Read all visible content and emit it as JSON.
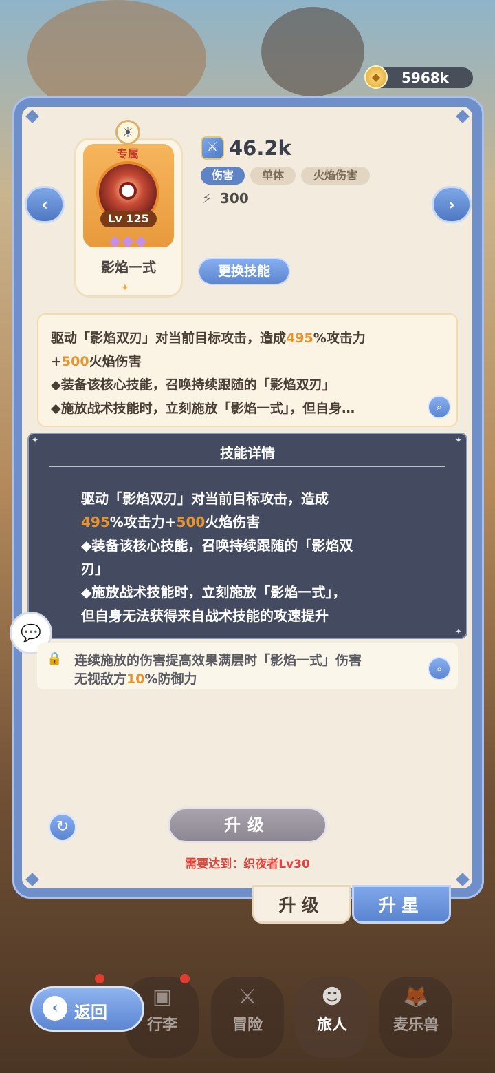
{
  "currency": {
    "icon": "coin-icon",
    "amount": "5968k"
  },
  "skill": {
    "exclusive_label": "专属",
    "level": "Lv 125",
    "stars": "◆◆◆",
    "name": "影焰一式",
    "power": "46.2k",
    "tags": [
      "伤害",
      "单体",
      "火焰伤害"
    ],
    "energy": "300",
    "change_button": "更换技能"
  },
  "description": {
    "line1_a": "驱动「影焰双刃」对当前目标攻击，造成",
    "line1_hl": "495",
    "line1_b": "%攻击力",
    "line2_a": "+",
    "line2_hl": "500",
    "line2_b": "火焰伤害",
    "line3": "◆装备该核心技能，召唤持续跟随的「影焰双刃」",
    "line4": "◆施放战术技能时，立刻施放「影焰一式」，但自身…"
  },
  "tooltip": {
    "title": "技能详情",
    "line1": "驱动「影焰双刃」对当前目标攻击，造成",
    "line2_hl1": "495",
    "line2_a": "%攻击力+",
    "line2_hl2": "500",
    "line2_b": "火焰伤害",
    "line3": "◆装备该核心技能，召唤持续跟随的「影焰双",
    "line4": "刃」",
    "line5": "◆施放战术技能时，立刻施放「影焰一式」，",
    "line6": "但自身无法获得来自战术技能的攻速提升"
  },
  "passive": {
    "line1": "连续施放的伤害提高效果满层时「影焰一式」伤害",
    "line2_a": "无视敌方",
    "line2_hl": "10",
    "line2_b": "%防御力"
  },
  "actions": {
    "upgrade_button": "升级",
    "requirement": "需要达到：织夜者Lv30"
  },
  "tabs": [
    {
      "label": "升级",
      "active": true
    },
    {
      "label": "升星",
      "active": false
    }
  ],
  "bottom_nav": {
    "back": "返回",
    "items": [
      {
        "label": "行李"
      },
      {
        "label": "冒险"
      },
      {
        "label": "旅人"
      },
      {
        "label": "麦乐兽"
      }
    ]
  },
  "colors": {
    "accent": "#5f84c6",
    "highlight": "#e8942a",
    "warning": "#e0453c"
  }
}
